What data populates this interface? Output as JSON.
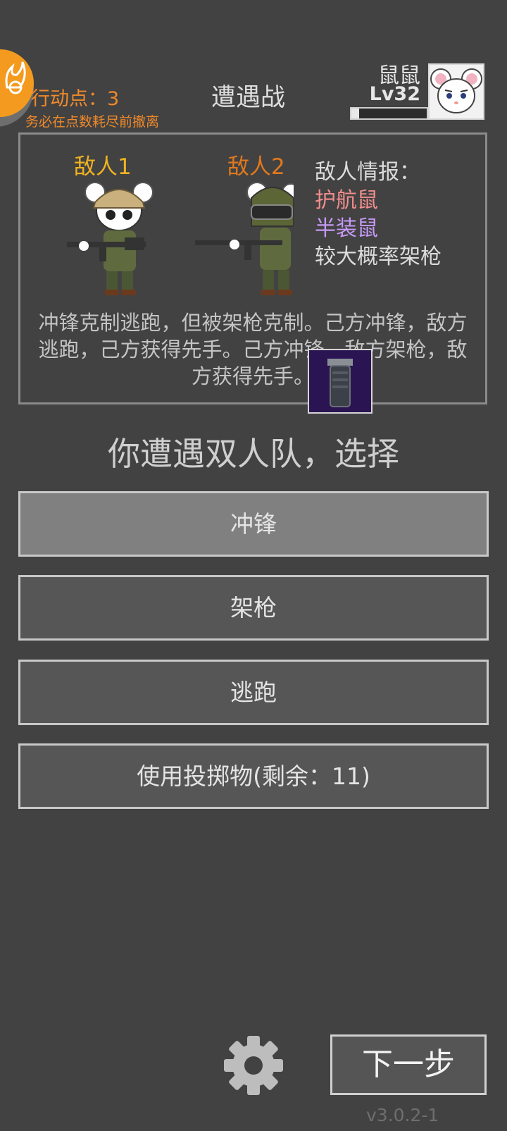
{
  "header": {
    "action_points_label": "行动点：3",
    "warning": "务必在点数耗尽前撤离",
    "title": "遭遇战",
    "player_name": "鼠鼠",
    "player_level": "Lv32",
    "hp_fraction": 0.1
  },
  "panel": {
    "enemy1_label": "敌人1",
    "enemy2_label": "敌人2",
    "intel_heading": "敌人情报：",
    "intel_lines": [
      "护航鼠",
      "半装鼠",
      "较大概率架枪"
    ],
    "rules_text": "冲锋克制逃跑，但被架枪克制。己方冲锋，敌方逃跑，己方获得先手。己方冲锋，敌方架枪，敌方获得先手。"
  },
  "prompt": "你遭遇双人队，选择",
  "actions": [
    "冲锋",
    "架枪",
    "逃跑",
    "使用投掷物(剩余：11)"
  ],
  "footer": {
    "next_label": "下一步",
    "version": "v3.0.2-1"
  },
  "colors": {
    "background": "#424242",
    "accent_orange": "#f08a2a",
    "enemy1_label": "#f0b321",
    "enemy2_label": "#e0791e",
    "intel_red": "#f28d8d",
    "intel_purple": "#c79af7"
  }
}
